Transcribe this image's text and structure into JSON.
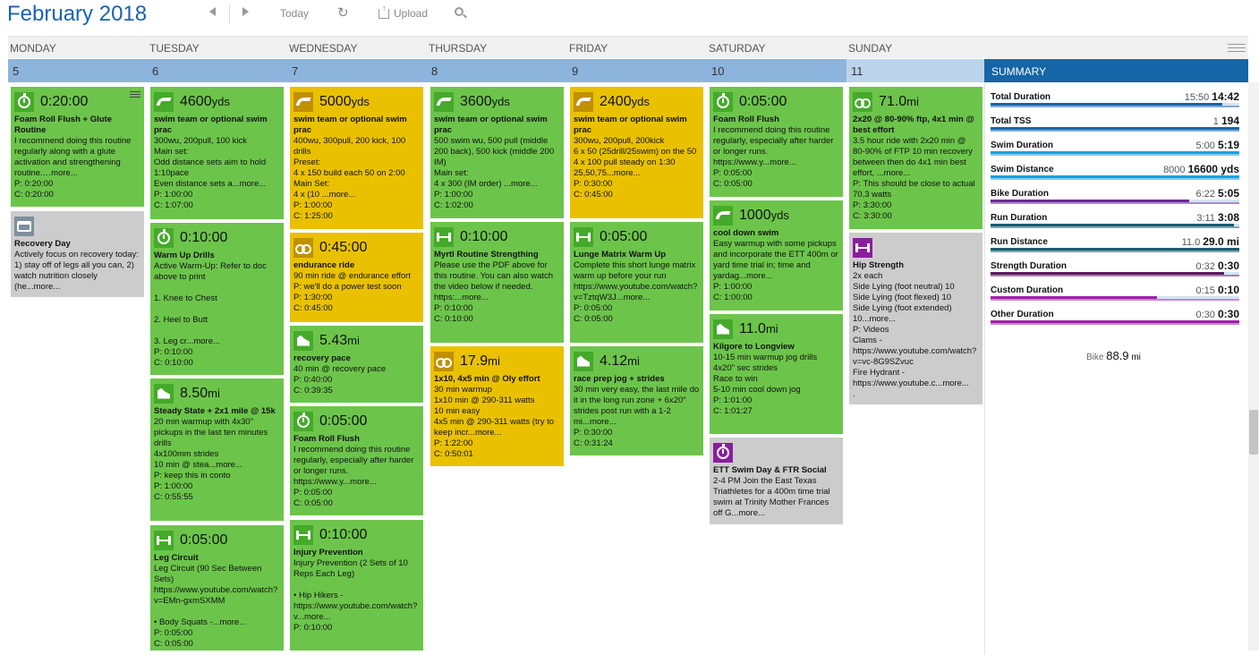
{
  "header": {
    "month": "February",
    "year": "2018"
  },
  "toolbar": {
    "today": "Today",
    "upload": "Upload"
  },
  "days": [
    "MONDAY",
    "TUESDAY",
    "WEDNESDAY",
    "THURSDAY",
    "FRIDAY",
    "SATURDAY",
    "SUNDAY"
  ],
  "dates": [
    "5",
    "6",
    "7",
    "8",
    "9",
    "10",
    "11"
  ],
  "summary_title": "SUMMARY",
  "cards": [
    {
      "metric": "0:20:00",
      "unit": "",
      "title": "Foam Roll Flush + Glute Routine",
      "desc": "I recommend doing this routine regularly along with a glute activation and strengthening routine.…more...",
      "p": "P: 0:20:00",
      "c": "C: 0:20:00",
      "icon": "stopwatch-icon"
    },
    {
      "metric": "",
      "unit": "",
      "title": "Recovery Day",
      "desc": "Actively focus on recovery today: 1) stay off of legs all you can, 2) watch nutrition closely (he...more...",
      "p": "",
      "c": "",
      "icon": "rest-icon"
    },
    {
      "metric": "4600",
      "unit": "yds",
      "title": "swim team or optional swim prac",
      "desc": "300wu, 200pull, 100 kick\nMain set:\nOdd distance sets aim to hold 1:10pace\nEven distance sets a...more...",
      "p": "P: 1:00:00",
      "c": "C: 1:07:00",
      "icon": "swim-icon"
    },
    {
      "metric": "0:10:00",
      "unit": "",
      "title": "Warm Up Drills",
      "desc": "Active Warm-Up: Refer to doc above to print\n\n1. Knee to Chest\n\n2. Heel to Butt\n\n3. Leg cr...more...",
      "p": "P: 0:10:00",
      "c": "C: 0:10:00",
      "icon": "stopwatch-icon"
    },
    {
      "metric": "8.50",
      "unit": "mi",
      "title": "Steady State + 2x1 mile @ 15k",
      "desc": "20 min warmup with 4x30\" pickups in the last ten minutes drills\n4x100mm strides\n10 min @ stea...more...",
      "p": "P: keep this in conto",
      "c": "P: 1:00:00\nC: 0:55:55",
      "icon": "run-icon"
    },
    {
      "metric": "0:05:00",
      "unit": "",
      "title": "Leg Circuit",
      "desc": "Leg Circuit (90 Sec Between Sets)\nhttps://www.youtube.com/watch?v=EMn-gxmSXMM\n\n• Body Squats -...more...",
      "p": "P: 0:05:00",
      "c": "C: 0:05:00",
      "icon": "strength-icon"
    },
    {
      "metric": "5000",
      "unit": "yds",
      "title": "swim team or optional swim prac",
      "desc": "400wu, 300pull, 200 kick, 100 drills\nPreset:\n4 x 150 build each 50 on 2:00\nMain Set:\n4 x (10 ...more...",
      "p": "P: 1:00:00",
      "c": "C: 1:25:00",
      "icon": "swim-icon"
    },
    {
      "metric": "0:45:00",
      "unit": "",
      "title": "endurance ride",
      "desc": "90 min ride @ endurance effort\nP: we'll do a power test soon",
      "p": "P: 1:30:00",
      "c": "C: 0:45:00",
      "icon": "bike-icon"
    },
    {
      "metric": "5.43",
      "unit": "mi",
      "title": "recovery pace",
      "desc": "40 min @ recovery pace",
      "p": "P: 0:40:00",
      "c": "C: 0:39:35",
      "icon": "run-icon"
    },
    {
      "metric": "0:05:00",
      "unit": "",
      "title": "Foam Roll Flush",
      "desc": "I recommend doing this routine regularly, especially after harder or longer runs.\nhttps://www.y...more...",
      "p": "P: 0:05:00",
      "c": "C: 0:05:00",
      "icon": "stopwatch-icon"
    },
    {
      "metric": "0:10:00",
      "unit": "",
      "title": "Injury Prevention",
      "desc": "Injury Prevention (2 Sets of 10 Reps Each Leg)\n\n• Hip Hikers -\nhttps://www.youtube.com/watch?v...more...",
      "p": "P: 0:10:00",
      "c": "",
      "icon": "strength-icon"
    },
    {
      "metric": "3600",
      "unit": "yds",
      "title": "swim team or optional swim prac",
      "desc": "500 swim wu, 500 pull (middle 200 back), 500 kick (middle 200 IM)\nMain set:\n4 x 300 (IM order) ...more...",
      "p": "P: 1:00:00",
      "c": "C: 1:02:00",
      "icon": "swim-icon"
    },
    {
      "metric": "0:10:00",
      "unit": "",
      "title": "Myrtl Routine Strengthing",
      "desc": "Please use the PDF above for this routine. You can also watch the video below if needed.\nhttps:...more...",
      "p": "P: 0:10:00",
      "c": "C: 0:10:00",
      "icon": "strength-icon"
    },
    {
      "metric": "17.9",
      "unit": "mi",
      "title": "1x10, 4x5 min @ Oly effort",
      "desc": "30 min warmup\n1x10 min @ 290-311 watts\n10 min easy\n4x5 min @ 290-311 watts (try to keep incr...more...",
      "p": "P: 1:22:00",
      "c": "C: 0:50:01",
      "icon": "bike-icon"
    },
    {
      "metric": "2400",
      "unit": "yds",
      "title": "swim team or optional swim prac",
      "desc": "300wu, 200pull, 200kick\n6 x 50 (25drill/25swim) on the 50\n4 x 100 pull steady on 1:30 25,50,75...more...",
      "p": "P: 0:30:00",
      "c": "C: 0:45:00",
      "icon": "swim-icon"
    },
    {
      "metric": "0:05:00",
      "unit": "",
      "title": "Lunge Matrix Warm Up",
      "desc": "Complete this short lunge matrix warm up before your run\nhttps://www.youtube.com/watch?v=TztqW3J...more...",
      "p": "P: 0:05:00",
      "c": "C: 0:05:00",
      "icon": "strength-icon"
    },
    {
      "metric": "4.12",
      "unit": "mi",
      "title": "race prep jog + strides",
      "desc": "30 min very easy, the last mile do it in the long run zone + 6x20\" strides post run with a 1-2 mi...more...",
      "p": "P: 0:30:00",
      "c": "C: 0:31:24",
      "icon": "run-icon"
    },
    {
      "metric": "0:05:00",
      "unit": "",
      "title": "Foam Roll Flush",
      "desc": "I recommend doing this routine regularly, especially after harder or longer runs.\nhttps://www.y...more...",
      "p": "P: 0:05:00",
      "c": "C: 0:05:00",
      "icon": "stopwatch-icon"
    },
    {
      "metric": "1000",
      "unit": "yds",
      "title": "cool down swim",
      "desc": "Easy warmup with some pickups and incorporate the ETT 400m or yard time trial in; time and yardag...more...",
      "p": "P: 1:00:00",
      "c": "C: 1:00:00",
      "icon": "swim-icon"
    },
    {
      "metric": "11.0",
      "unit": "mi",
      "title": "Kilgore to Longview",
      "desc": "10-15 min warmup jog drills\n4x20\" sec strides\nRace to win\n5-10 min cool down jog",
      "p": "P: 1:01:00",
      "c": "C: 1:01:27",
      "icon": "run-icon"
    },
    {
      "metric": "",
      "unit": "",
      "title": "ETT Swim Day & FTR Social",
      "desc": "2-4 PM Join the East Texas Triathletes for a 400m time trial swim at Trinity Mother Frances off G...more...",
      "p": "",
      "c": "",
      "icon": "stopwatch-icon"
    },
    {
      "metric": "71.0",
      "unit": "mi",
      "title": "2x20 @ 80-90% ftp, 4x1 min @ best effort",
      "desc": "3.5 hour ride with 2x20 min @ 80-90% of FTP 10 min recovery between then do 4x1 min best effort, ...more...\nP: This should be close to actual 70.3 watts",
      "p": "P: 3:30:00",
      "c": "C: 3:30:00",
      "icon": "bike-icon"
    },
    {
      "metric": "",
      "unit": "",
      "title": "Hip Strength",
      "desc": "2x each\nSide Lying (foot neutral) 10\nSide Lying (foot flexed) 10\nSide Lying (foot extended) 10...more...\nP: Videos\nClams -\nhttps://www.youtube.com/watch?v=vc-8G9SZvuc\nFire Hydrant -\nhttps://www.youtube.c...more...\n.",
      "p": "",
      "c": "",
      "icon": "strength-icon"
    }
  ],
  "summary": [
    {
      "label": "Total Duration",
      "planned": "15:50",
      "actual": "14:42",
      "color": "#1565a9",
      "frac": 0.93
    },
    {
      "label": "Total TSS",
      "planned": "1",
      "actual": "194",
      "color": "#1565a9",
      "frac": 1.0
    },
    {
      "label": "Swim Duration",
      "planned": "5:00",
      "actual": "5:19",
      "color": "#1aa1e0",
      "frac": 1.0
    },
    {
      "label": "Swim Distance",
      "planned": "8000",
      "actual": "16600 yds",
      "color": "#1aa1e0",
      "frac": 1.0
    },
    {
      "label": "Bike Duration",
      "planned": "6:22",
      "actual": "5:05",
      "color": "#6a2c91",
      "frac": 0.8
    },
    {
      "label": "Run Duration",
      "planned": "3:11",
      "actual": "3:08",
      "color": "#1a5b6e",
      "frac": 0.98
    },
    {
      "label": "Run Distance",
      "planned": "11.0",
      "actual": "29.0 mi",
      "color": "#1a5b6e",
      "frac": 1.0
    },
    {
      "label": "Strength Duration",
      "planned": "0:32",
      "actual": "0:30",
      "color": "#5a1a5e",
      "frac": 0.94
    },
    {
      "label": "Custom Duration",
      "planned": "0:15",
      "actual": "0:10",
      "color": "#a020a8",
      "frac": 0.67
    },
    {
      "label": "Other Duration",
      "planned": "0:30",
      "actual": "0:30",
      "color": "#a020a8",
      "frac": 1.0
    }
  ],
  "bike_total": {
    "label": "Bike",
    "value": "88.9",
    "unit": "mi"
  }
}
